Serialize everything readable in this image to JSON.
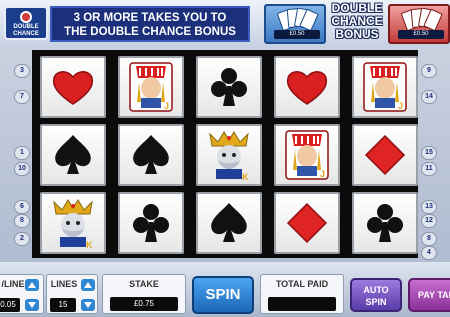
{
  "logo": {
    "line1": "DOUBLE",
    "line2": "CHANCE"
  },
  "banner": {
    "line1": "3 OR MORE TAKES YOU TO",
    "line2": "THE DOUBLE CHANCE BONUS"
  },
  "double_chance": {
    "title_line1": "DOUBLE",
    "title_line2": "CHANCE",
    "title_line3": "BONUS",
    "left_price": "£0.50",
    "right_price": "£0.50"
  },
  "paylines_left": [
    "3",
    "7",
    "1",
    "10",
    "6",
    "8",
    "2"
  ],
  "paylines_right": [
    "9",
    "14",
    "15",
    "11",
    "13",
    "12",
    "8",
    "4"
  ],
  "reels": [
    [
      "heart",
      "jack",
      "club",
      "heart",
      "jack"
    ],
    [
      "spade",
      "spade",
      "king",
      "jack",
      "diamond"
    ],
    [
      "king",
      "club",
      "spade",
      "diamond",
      "club"
    ]
  ],
  "controls": {
    "line_label": "/LINE",
    "line_value": "0.05",
    "lines_label": "LINES",
    "lines_value": "15",
    "stake_label": "STAKE",
    "stake_value": "£0.75",
    "spin_label": "SPIN",
    "total_paid_label": "TOTAL PAID",
    "total_paid_value": "",
    "auto_label_1": "AUTO",
    "auto_label_2": "SPIN",
    "paytable_label": "PAY TAB"
  },
  "colors": {
    "heart": "#d91f1f",
    "diamond": "#e02424",
    "spade": "#111111",
    "club": "#111111",
    "crown": "#e0a81a",
    "banner": "#1b2f7a"
  }
}
